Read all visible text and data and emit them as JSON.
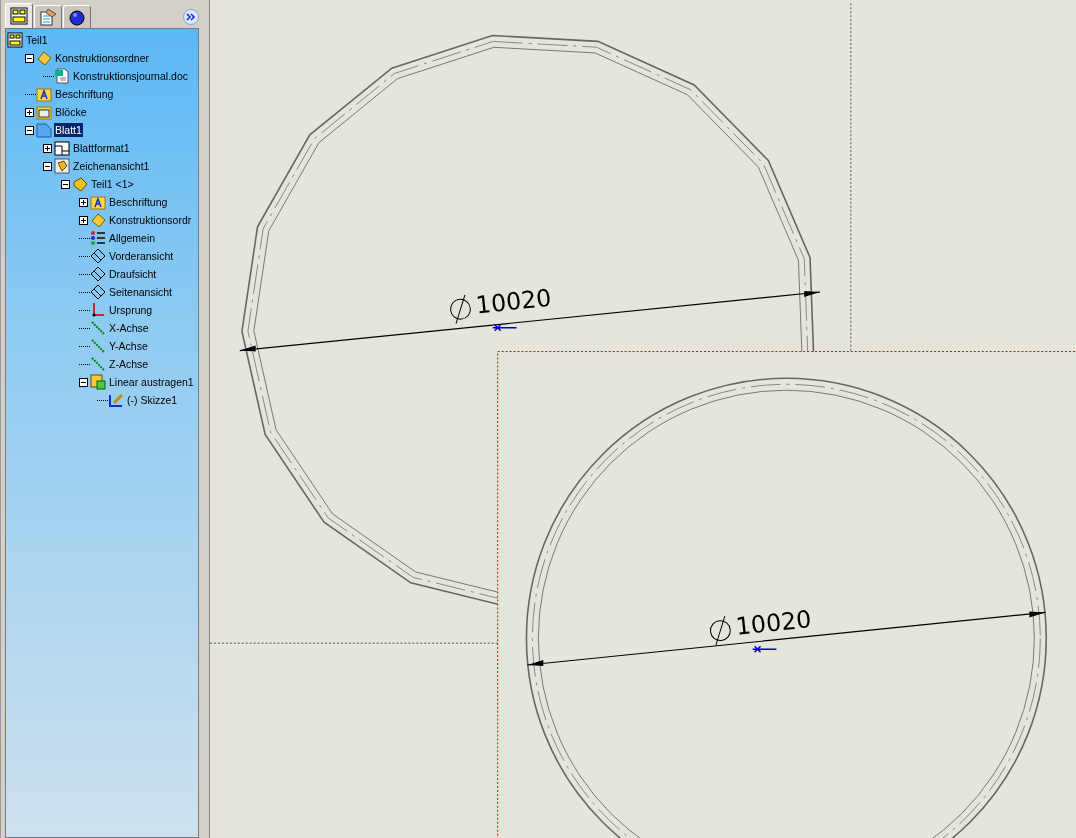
{
  "panel_tabs": [
    {
      "kind": "model",
      "selected": true
    },
    {
      "kind": "notes",
      "selected": false
    },
    {
      "kind": "render",
      "selected": false
    }
  ],
  "tree": [
    {
      "label": "Teil1",
      "kind": "part",
      "selected": false,
      "children": [
        {
          "label": "Konstruktionsordner",
          "kind": "design-folder",
          "selected": false,
          "expanded": true,
          "children": [
            {
              "label": "Konstruktionsjournal.doc",
              "kind": "document",
              "selected": false
            }
          ]
        },
        {
          "label": "Beschriftung",
          "kind": "annotation",
          "selected": false
        },
        {
          "label": "Blöcke",
          "kind": "blocks",
          "selected": false,
          "expanded": false
        },
        {
          "label": "Blatt1",
          "kind": "sheet",
          "selected": true,
          "expanded": true,
          "children": [
            {
              "label": "Blattformat1",
              "kind": "sheet-format",
              "selected": false,
              "expanded": false
            },
            {
              "label": "Zeichenansicht1",
              "kind": "view",
              "selected": false,
              "expanded": true,
              "children": [
                {
                  "label": "Teil1 <1>",
                  "kind": "part-instance",
                  "selected": false,
                  "expanded": true,
                  "children": [
                    {
                      "label": "Beschriftung",
                      "kind": "annotation",
                      "selected": false,
                      "expanded": false
                    },
                    {
                      "label": "Konstruktionsordr",
                      "kind": "design-folder",
                      "selected": false,
                      "expanded": false
                    },
                    {
                      "label": "Allgemein",
                      "kind": "parameters",
                      "selected": false
                    },
                    {
                      "label": "Vorderansicht",
                      "kind": "plane",
                      "selected": false
                    },
                    {
                      "label": "Draufsicht",
                      "kind": "plane",
                      "selected": false
                    },
                    {
                      "label": "Seitenansicht",
                      "kind": "plane",
                      "selected": false
                    },
                    {
                      "label": "Ursprung",
                      "kind": "origin",
                      "selected": false
                    },
                    {
                      "label": "X-Achse",
                      "kind": "axis",
                      "selected": false
                    },
                    {
                      "label": "Y-Achse",
                      "kind": "axis",
                      "selected": false
                    },
                    {
                      "label": "Z-Achse",
                      "kind": "axis",
                      "selected": false
                    },
                    {
                      "label": "Linear austragen1",
                      "kind": "extrusion",
                      "selected": false,
                      "expanded": true,
                      "children": [
                        {
                          "label": "(-) Skizze1",
                          "kind": "sketch",
                          "selected": false
                        }
                      ]
                    }
                  ]
                }
              ]
            }
          ]
        }
      ]
    }
  ],
  "drawing_views": [
    {
      "kind": "polygon",
      "dimension": "10020"
    },
    {
      "kind": "circle",
      "dimension": "10020"
    }
  ]
}
